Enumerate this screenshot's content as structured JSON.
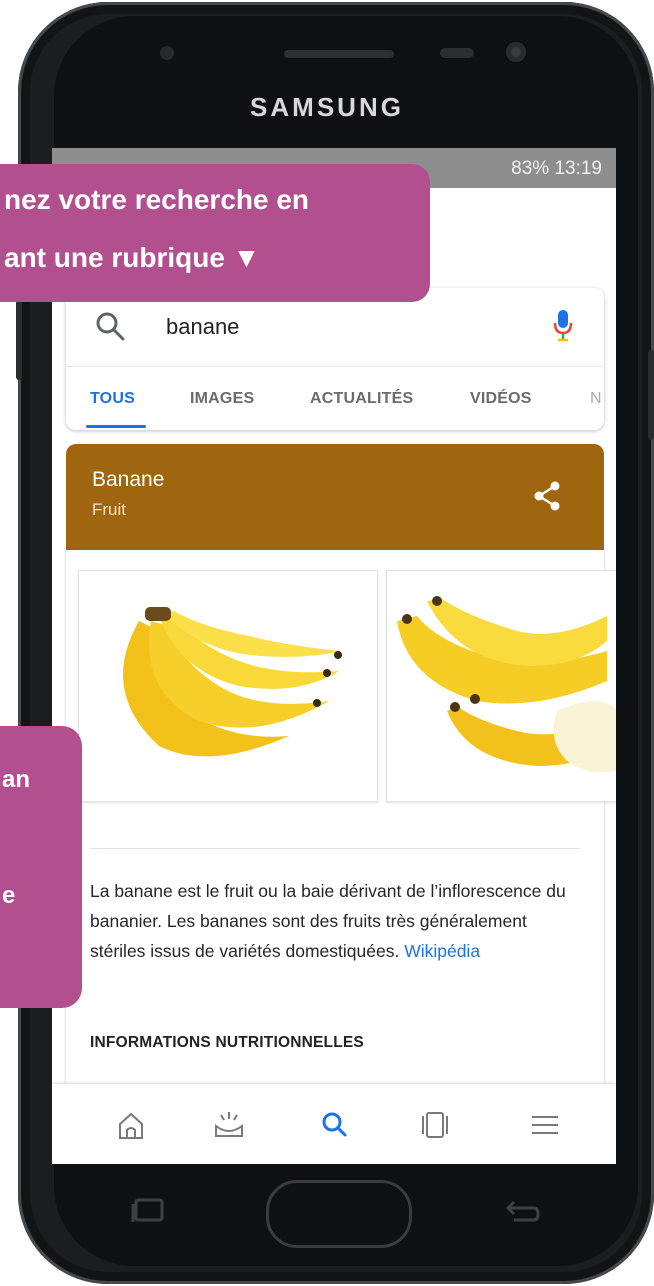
{
  "device": {
    "brand": "SAMSUNG"
  },
  "status_bar": {
    "text": "83% 13:19"
  },
  "search": {
    "query": "banane"
  },
  "tabs": [
    {
      "label": "TOUS"
    },
    {
      "label": "IMAGES"
    },
    {
      "label": "ACTUALITÉS"
    },
    {
      "label": "VIDÉOS"
    },
    {
      "label": "N"
    }
  ],
  "knowledge_panel": {
    "title": "Banane",
    "subtitle": "Fruit",
    "color": "#a0650f",
    "description": "La banane est le fruit ou la baie dérivant de l’inflorescence du bananier. Les bananes sont des fruits très généralement stériles issus de variétés domestiquées.",
    "source_link": "Wikipédia",
    "section_heading": "INFORMATIONS NUTRITIONNELLES"
  },
  "images": [
    {
      "alt": "banana-bunch-image"
    },
    {
      "alt": "bananas-peeled-image"
    }
  ],
  "bottom_nav": [
    "home-icon",
    "updates-icon",
    "search-icon",
    "tabs-icon",
    "menu-icon"
  ],
  "callouts": {
    "top_line1": "nez votre recherche en",
    "top_line2": "ant une rubrique ▼",
    "left_line1": "an",
    "left_line2": "e",
    "color": "#b2508f"
  },
  "accent": "#1a73e8"
}
